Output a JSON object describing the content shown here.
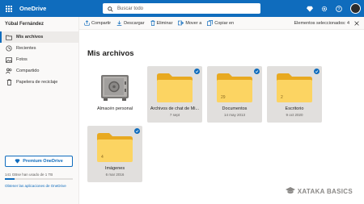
{
  "header": {
    "app_title": "OneDrive",
    "search_placeholder": "Buscar todo",
    "colors": {
      "brand": "#0f6cbd"
    }
  },
  "sidebar": {
    "username": "Yúbal Fernández",
    "items": [
      {
        "label": "Mis archivos",
        "icon": "folder-icon",
        "active": true
      },
      {
        "label": "Recientes",
        "icon": "clock-icon",
        "active": false
      },
      {
        "label": "Fotos",
        "icon": "image-icon",
        "active": false
      },
      {
        "label": "Compartido",
        "icon": "people-icon",
        "active": false
      },
      {
        "label": "Papelera de reciclaje",
        "icon": "trash-icon",
        "active": false
      }
    ],
    "premium_label": "Premium OneDrive",
    "storage_text": "141 GBse han usado de 1 TB",
    "storage_fraction": 0.14,
    "get_apps_label": "Obtener las aplicaciones de OneDrive"
  },
  "toolbar": {
    "share_label": "Compartir",
    "download_label": "Descargar",
    "delete_label": "Eliminar",
    "move_label": "Mover a",
    "copy_label": "Copiar en",
    "selected_text": "Elementos seleccionados: 4"
  },
  "main": {
    "title": "Mis archivos",
    "items": [
      {
        "name": "Almacén personal",
        "date": "",
        "count": "",
        "type": "vault",
        "selected": false
      },
      {
        "name": "Archivos de chat de Mi...",
        "date": "7 sept",
        "count": "",
        "type": "folder",
        "selected": true
      },
      {
        "name": "Documentos",
        "date": "14 may 2013",
        "count": "29",
        "type": "folder",
        "selected": true
      },
      {
        "name": "Escritorio",
        "date": "9 oct 2020",
        "count": "2",
        "type": "folder",
        "selected": true
      },
      {
        "name": "Imágenes",
        "date": "6 mar 2016",
        "count": "4",
        "type": "folder",
        "selected": true
      }
    ]
  },
  "watermark": {
    "text": "XATAKA BASICS"
  }
}
